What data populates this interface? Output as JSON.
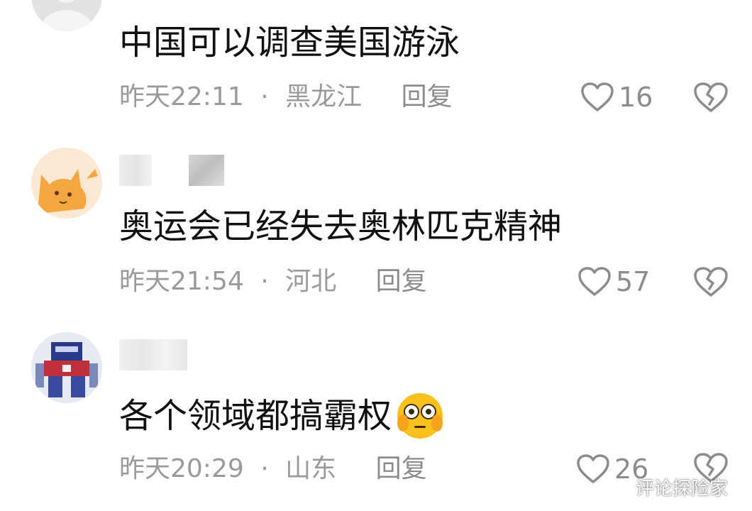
{
  "comments": [
    {
      "text": "中国可以调查美国游泳",
      "time": "昨天22:11",
      "sep": "·",
      "location": "黑龙江",
      "reply": "回复",
      "likes": "16"
    },
    {
      "text": "奥运会已经失去奥林匹克精神",
      "time": "昨天21:54",
      "sep": "·",
      "location": "河北",
      "reply": "回复",
      "likes": "57"
    },
    {
      "text": "各个领域都搞霸权",
      "emoji": "😳",
      "time": "昨天20:29",
      "sep": "·",
      "location": "山东",
      "reply": "回复",
      "likes": "26"
    }
  ],
  "watermark": "评论探险家",
  "colors": {
    "text": "#111111",
    "meta": "#9a9a9a",
    "icon": "#8c8c8c",
    "avatar_cat_bg": "#f4a640"
  }
}
